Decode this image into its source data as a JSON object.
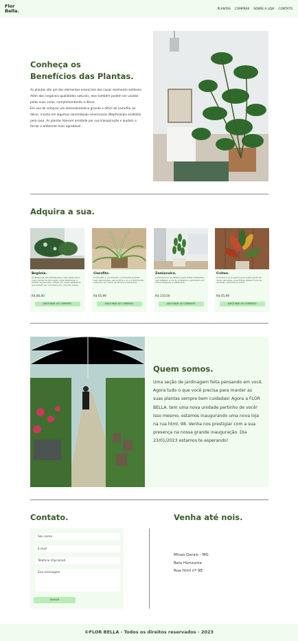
{
  "header": {
    "logo_line1": "Flor",
    "logo_line2": "Bella.",
    "nav": [
      "PLANTAS",
      "COMPRAR",
      "SOBRE A LOJA",
      "CONTATO"
    ]
  },
  "hero": {
    "title_line1": "Conheça os",
    "title_line2": "Benefícios das Plantas.",
    "paragraph1": "As plantas são um dos elementos essenciais das casas realmente estilosas. Além das inegáveis qualidades naturais, elas também podem ser usadas pelas suas cores, complementando o décor.",
    "paragraph2": "Em vez de comprar um eletrodoméstico grande e difícil de camuflar ao décor, invista em algumas samambaias-americanas (Nephrolepis exaltata) pela casa. As plantas liberam umidade por sua transpiração e ajudam a tornar o ambiente mais agradável."
  },
  "shop": {
    "title": "Adquira a sua.",
    "button_label": "ADICIONAR AO CARRINHO",
    "products": [
      {
        "name": "Begônia.",
        "desc": "As Begônias são plantas para casa ideais para quem gosta de decoração mais elaborada. A melhor opção para cultivar em vasos pequenos que podem ser colocados em cima de mesas.",
        "price": "R$ 80,00"
      },
      {
        "name": "Clorofito.",
        "desc": "O Clorofito é um arbusto ornamental perfeito para decorações, ele purifica o ar e é facilmente cultivado em vasos de diversos tamanhos.",
        "price": "R$ 65,99"
      },
      {
        "name": "Zamioculca.",
        "desc": "A Zamioculca se destaca pela folhas brilhantes, que refletem a luz do ambiente e garantem um visual elegante e sofisticado.",
        "price": "R$ 110,00"
      },
      {
        "name": "Cróton.",
        "desc": "O Cróton é uma planta para quem gosta de cores vibrantes, suas folhas exibem tons de amarelo, vermelho e verde.",
        "price": "R$ 45,99"
      }
    ]
  },
  "about": {
    "title": "Quem somos.",
    "text": "Uma seção de jardinagem feita pensando em você. Agora tudo o que você precisa para manter as suas plantas sempre bem cuidadas! Agora a FLOR BELLA. tem uma nova unidade pertinho de você! Isso mesmo, estamos inaugurando uma nova loja na rua html, 98. Venha nos prestigiar com a sua presença na nossa grande inauguração. Dia 23/01/2023 estamos te esperando!"
  },
  "contact": {
    "title": "Contato.",
    "name_placeholder": "Seu nome",
    "email_placeholder": "E-mail",
    "phone_placeholder": "Telefone (Opcional)",
    "message_placeholder": "Sua mensagem",
    "send_label": "ENVIAR"
  },
  "visit": {
    "title": "Venha até nois.",
    "line1": "Minas Gerais - MG",
    "line2": "Belo Horizonte",
    "line3": "Rua html nº 98"
  },
  "footer": {
    "text": "©FLOR BELLA - Todos os direitos reservados - 2023"
  },
  "colors": {
    "accent": "#3b5b2a",
    "panel": "#f1fbef",
    "button": "#b9ecb6"
  }
}
